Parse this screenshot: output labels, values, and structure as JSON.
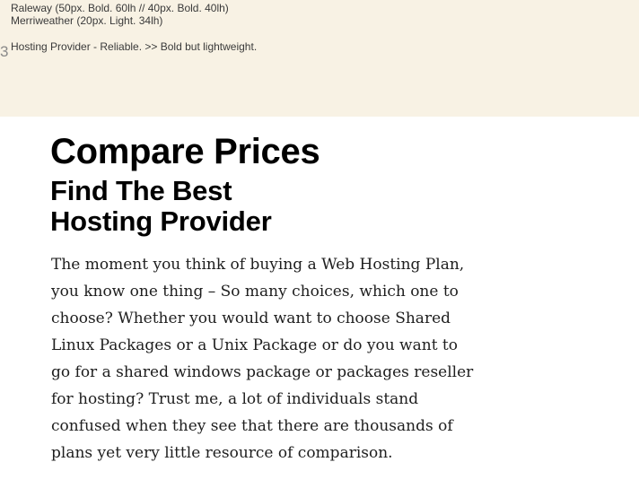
{
  "notes": {
    "line1": "Raleway (50px. Bold. 60lh // 40px. Bold. 40lh)",
    "line2": "Merriweather (20px. Light. 34lh)",
    "marker": "3",
    "line3": "Hosting Provider - Reliable. >> Bold but lightweight."
  },
  "main": {
    "heading": "Compare Prices",
    "subheading_lines": [
      "Find The Best",
      "Hosting Provider"
    ],
    "paragraph_lines": [
      "The moment you think of buying a Web Hosting Plan,",
      "you know one thing – So many choices, which one to",
      "choose? Whether you would want to choose Shared",
      "Linux Packages or a Unix Package or do you want to",
      "go for a shared windows package or packages reseller",
      "for hosting? Trust me, a lot of individuals stand",
      "confused when they see that there are thousands of",
      "plans yet very little resource of comparison."
    ]
  },
  "colors": {
    "notes_background": "#f8f2e4",
    "page_background": "#ffffff",
    "heading": "#000000",
    "body": "#1e1e1e"
  }
}
